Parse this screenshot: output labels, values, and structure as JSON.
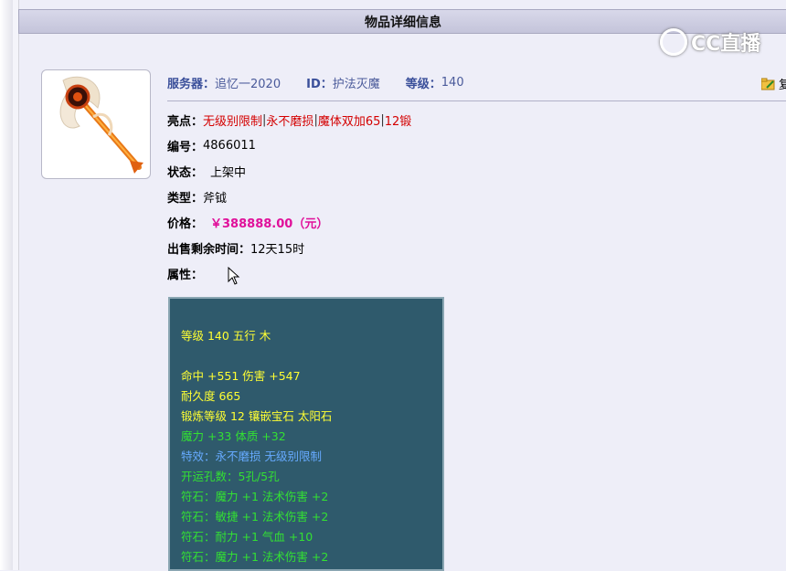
{
  "header": {
    "title": "物品详细信息"
  },
  "watermark": {
    "text": "CC直播"
  },
  "meta": {
    "server_label": "服务器：",
    "server_value": "追忆一2020",
    "id_label": "ID：",
    "id_value": "护法灭魔",
    "level_label": "等级：",
    "level_value": "140",
    "copy_label": "复"
  },
  "fields": {
    "highlights_label": "亮点：",
    "highlights": [
      "无级别限制",
      "永不磨损",
      "魔体双加65",
      "12锻"
    ],
    "highlight_sep": "|",
    "number_label": "编号：",
    "number_value": "4866011",
    "status_label": "状态：",
    "status_value": "上架中",
    "type_label": "类型：",
    "type_value": "斧钺",
    "price_label": "价格：",
    "price_value": "￥388888.00（元）",
    "remaining_label": "出售剩余时间：",
    "remaining_value": "12天15时",
    "attr_label": "属性："
  },
  "attributes": [
    {
      "text": "等级 140 五行 木",
      "color": "yellow"
    },
    {
      "text": "命中 +551 伤害 +547",
      "color": "yellow"
    },
    {
      "text": "耐久度 665",
      "color": "yellow"
    },
    {
      "text": "锻炼等级 12 镶嵌宝石 太阳石",
      "color": "yellow"
    },
    {
      "text": "魔力 +33 体质 +32",
      "color": "green"
    },
    {
      "text": "特效：永不磨损 无级别限制",
      "color": "blue"
    },
    {
      "text": "开运孔数：5孔/5孔",
      "color": "green"
    },
    {
      "text": "符石：魔力 +1 法术伤害 +2",
      "color": "green"
    },
    {
      "text": "符石：敏捷 +1 法术伤害 +2",
      "color": "green"
    },
    {
      "text": "符石：耐力 +1 气血 +10",
      "color": "green"
    },
    {
      "text": "符石：魔力 +1 法术伤害 +2",
      "color": "green"
    }
  ],
  "colors": {
    "accent": "#3a4f9a",
    "highlight": "#d40000",
    "price": "#e0109a",
    "panel_bg": "#2f5a6c"
  }
}
